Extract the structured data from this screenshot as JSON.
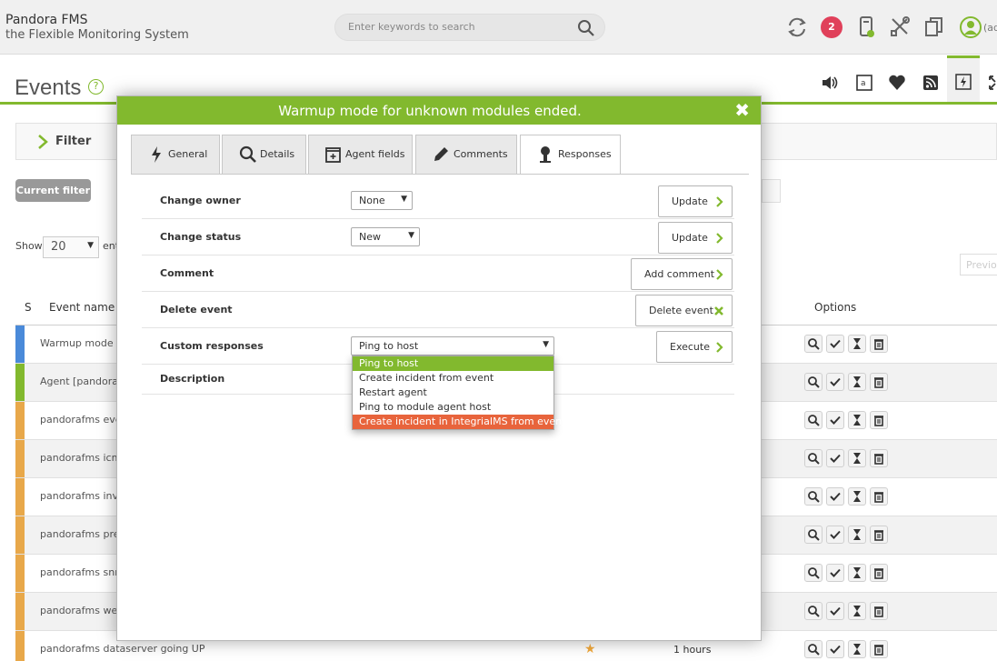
{
  "header": {
    "brand_title": "Pandora FMS",
    "brand_subtitle": "the Flexible Monitoring System",
    "search_placeholder": "Enter keywords to search",
    "notification_count": "2",
    "user_label": "(ad"
  },
  "page": {
    "title": "Events",
    "help_symbol": "?"
  },
  "background": {
    "filter_label": "Filter",
    "current_filter": "Current filter",
    "show_label": "Show",
    "show_value": "20",
    "entries_label": "ent",
    "previous_label": "Previou",
    "columns": {
      "s": "S",
      "event_name": "Event name",
      "options": "Options"
    },
    "rows": [
      {
        "name": "Warmup mode fo",
        "color": "#4a8ad9"
      },
      {
        "name": "Agent [pandoraf",
        "color": "#82b92e"
      },
      {
        "name": "pandorafms ever",
        "color": "#e8a84a"
      },
      {
        "name": "pandorafms icmp",
        "color": "#e8a84a"
      },
      {
        "name": "pandorafms inve",
        "color": "#e8a84a"
      },
      {
        "name": "pandorafms pred",
        "color": "#e8a84a"
      },
      {
        "name": "pandorafms snm",
        "color": "#e8a84a"
      },
      {
        "name": "pandorafms web",
        "color": "#e8a84a"
      },
      {
        "name": "pandorafms dataserver going UP",
        "color": "#e8a84a",
        "time": "1 hours"
      }
    ]
  },
  "modal": {
    "title": "Warmup mode for unknown modules ended.",
    "close_symbol": "✖",
    "tabs": [
      "General",
      "Details",
      "Agent fields",
      "Comments",
      "Responses"
    ],
    "active_tab": "Responses",
    "rows": {
      "change_owner": {
        "label": "Change owner",
        "select": "None",
        "button": "Update"
      },
      "change_status": {
        "label": "Change status",
        "select": "New",
        "button": "Update"
      },
      "comment": {
        "label": "Comment",
        "button": "Add comment"
      },
      "delete_event": {
        "label": "Delete event",
        "button": "Delete event"
      },
      "custom_responses": {
        "label": "Custom responses",
        "select": "Ping to host",
        "button": "Execute"
      },
      "description": {
        "label": "Description"
      }
    },
    "dropdown_options": [
      "Ping to host",
      "Create incident from event",
      "Restart agent",
      "Ping to module agent host",
      "Create incident in IntegriaIMS from event"
    ]
  },
  "colors": {
    "accent": "#82b92e",
    "highlight": "#e8643c",
    "badge": "#e0405a"
  }
}
